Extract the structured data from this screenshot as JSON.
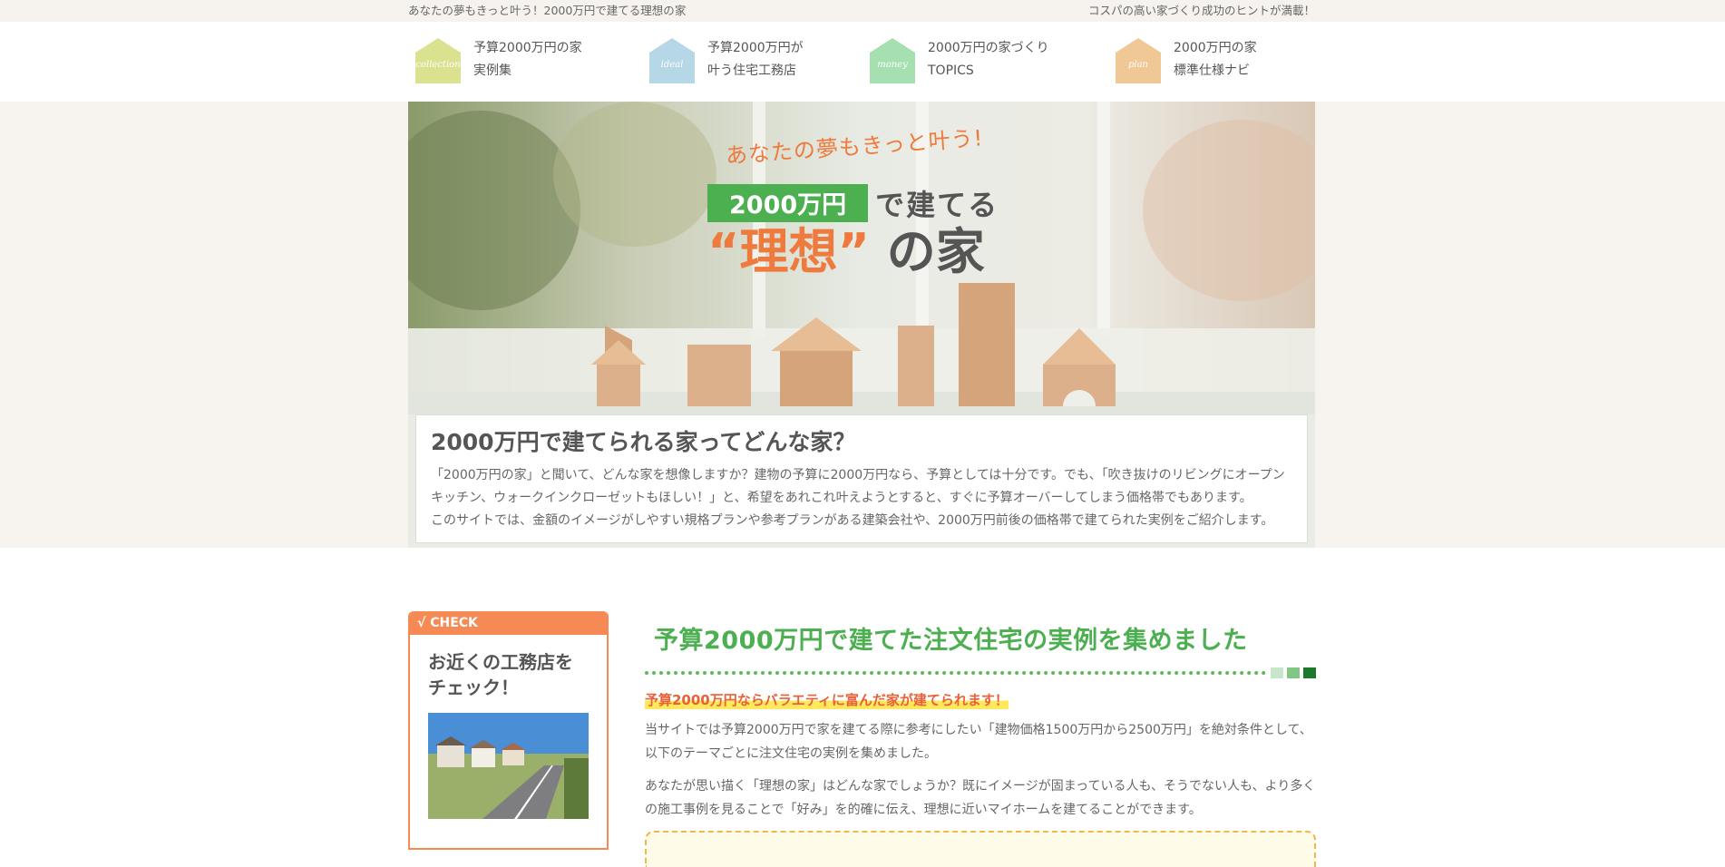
{
  "topbar": {
    "left": "あなたの夢もきっと叶う！2000万円で建てる理想の家",
    "right": "コスパの高い家づくり成功のヒントが満載！"
  },
  "nav": [
    {
      "tag": "collection",
      "line1": "予算2000万円の家",
      "line2": "実例集",
      "color": "#dbe28f"
    },
    {
      "tag": "ideal",
      "line1": "予算2000万円が",
      "line2": "叶う住宅工務店",
      "color": "#b6d7e6"
    },
    {
      "tag": "money",
      "line1": "2000万円の家づくり",
      "line2": "TOPICS",
      "color": "#a6e0b0"
    },
    {
      "tag": "plan",
      "line1": "2000万円の家",
      "line2": "標準仕様ナビ",
      "color": "#f0c896"
    }
  ],
  "hero": {
    "sub": "あなたの夢もきっと叶う!",
    "price": "2000万円",
    "dete": "で建てる",
    "ideal": "“理想”",
    "rest": "の家"
  },
  "intro": {
    "title": "2000万円で建てられる家ってどんな家？",
    "p1": "「2000万円の家」と聞いて、どんな家を想像しますか？建物の予算に2000万円なら、予算としては十分です。でも、「吹き抜けのリビングにオープンキッチン、ウォークインクローゼットもほしい！」と、希望をあれこれ叶えようとすると、すぐに予算オーバーしてしまう価格帯でもあります。",
    "p2": "このサイトでは、金額のイメージがしやすい規格プランや参考プランがある建築会社や、2000万円前後の価格帯で建てられた実例をご紹介します。"
  },
  "side": {
    "head": "√ CHECK",
    "title": "お近くの工務店をチェック！"
  },
  "main": {
    "title": "予算2000万円で建てた注文住宅の実例を集めました",
    "highlight": "予算2000万円ならバラエティに富んだ家が建てられます！",
    "p1": "当サイトでは予算2000万円で家を建てる際に参考にしたい「建物価格1500万円から2500万円」を絶対条件として、以下のテーマごとに注文住宅の実例を集めました。",
    "p2": "あなたが思い描く「理想の家」はどんな家でしょうか？既にイメージが固まっている人も、そうでない人も、より多くの施工事例を見ることで「好み」を的確に伝え、理想に近いマイホームを建てることができます。"
  },
  "colors": {
    "green": "#4caf50",
    "orange": "#f58a55",
    "accent": "#ef7a3d",
    "sq1": "#c8e6c9",
    "sq2": "#81c784",
    "sq3": "#1b7a2a"
  }
}
